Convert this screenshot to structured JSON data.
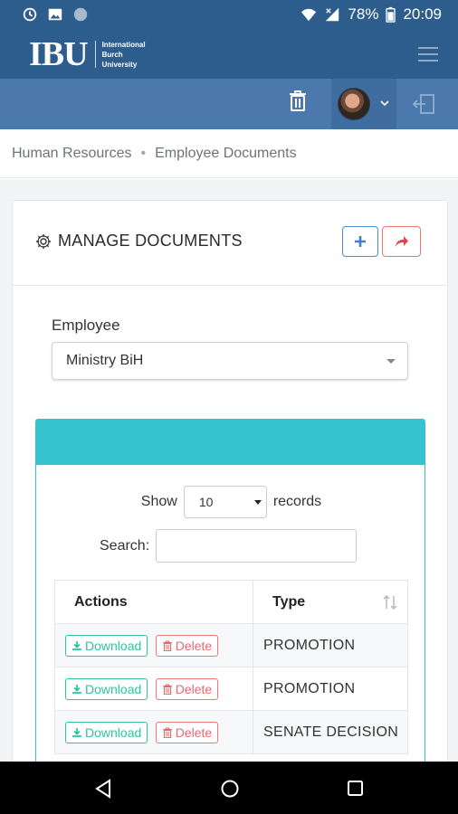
{
  "status_bar": {
    "battery": "78%",
    "time": "20:09"
  },
  "header": {
    "logo": "IBU",
    "logo_subtitle": [
      "International",
      "Burch",
      "University"
    ]
  },
  "breadcrumb": {
    "items": [
      "Human Resources",
      "Employee Documents"
    ]
  },
  "card": {
    "title": "MANAGE DOCUMENTS"
  },
  "employee": {
    "label": "Employee",
    "selected": "Ministry BiH"
  },
  "table_controls": {
    "show_label": "Show",
    "page_length": "10",
    "records_label": "records",
    "search_label": "Search:",
    "search_value": ""
  },
  "table": {
    "columns": [
      "Actions",
      "Type"
    ],
    "download_label": "Download",
    "delete_label": "Delete",
    "rows": [
      {
        "type": "PROMOTION"
      },
      {
        "type": "PROMOTION"
      },
      {
        "type": "SENATE DECISION"
      }
    ]
  },
  "colors": {
    "primary": "#2d5d8c",
    "secondary": "#4b79ad",
    "panel": "#35c3cf",
    "download": "#2fc3a0",
    "delete": "#e46a6d"
  }
}
